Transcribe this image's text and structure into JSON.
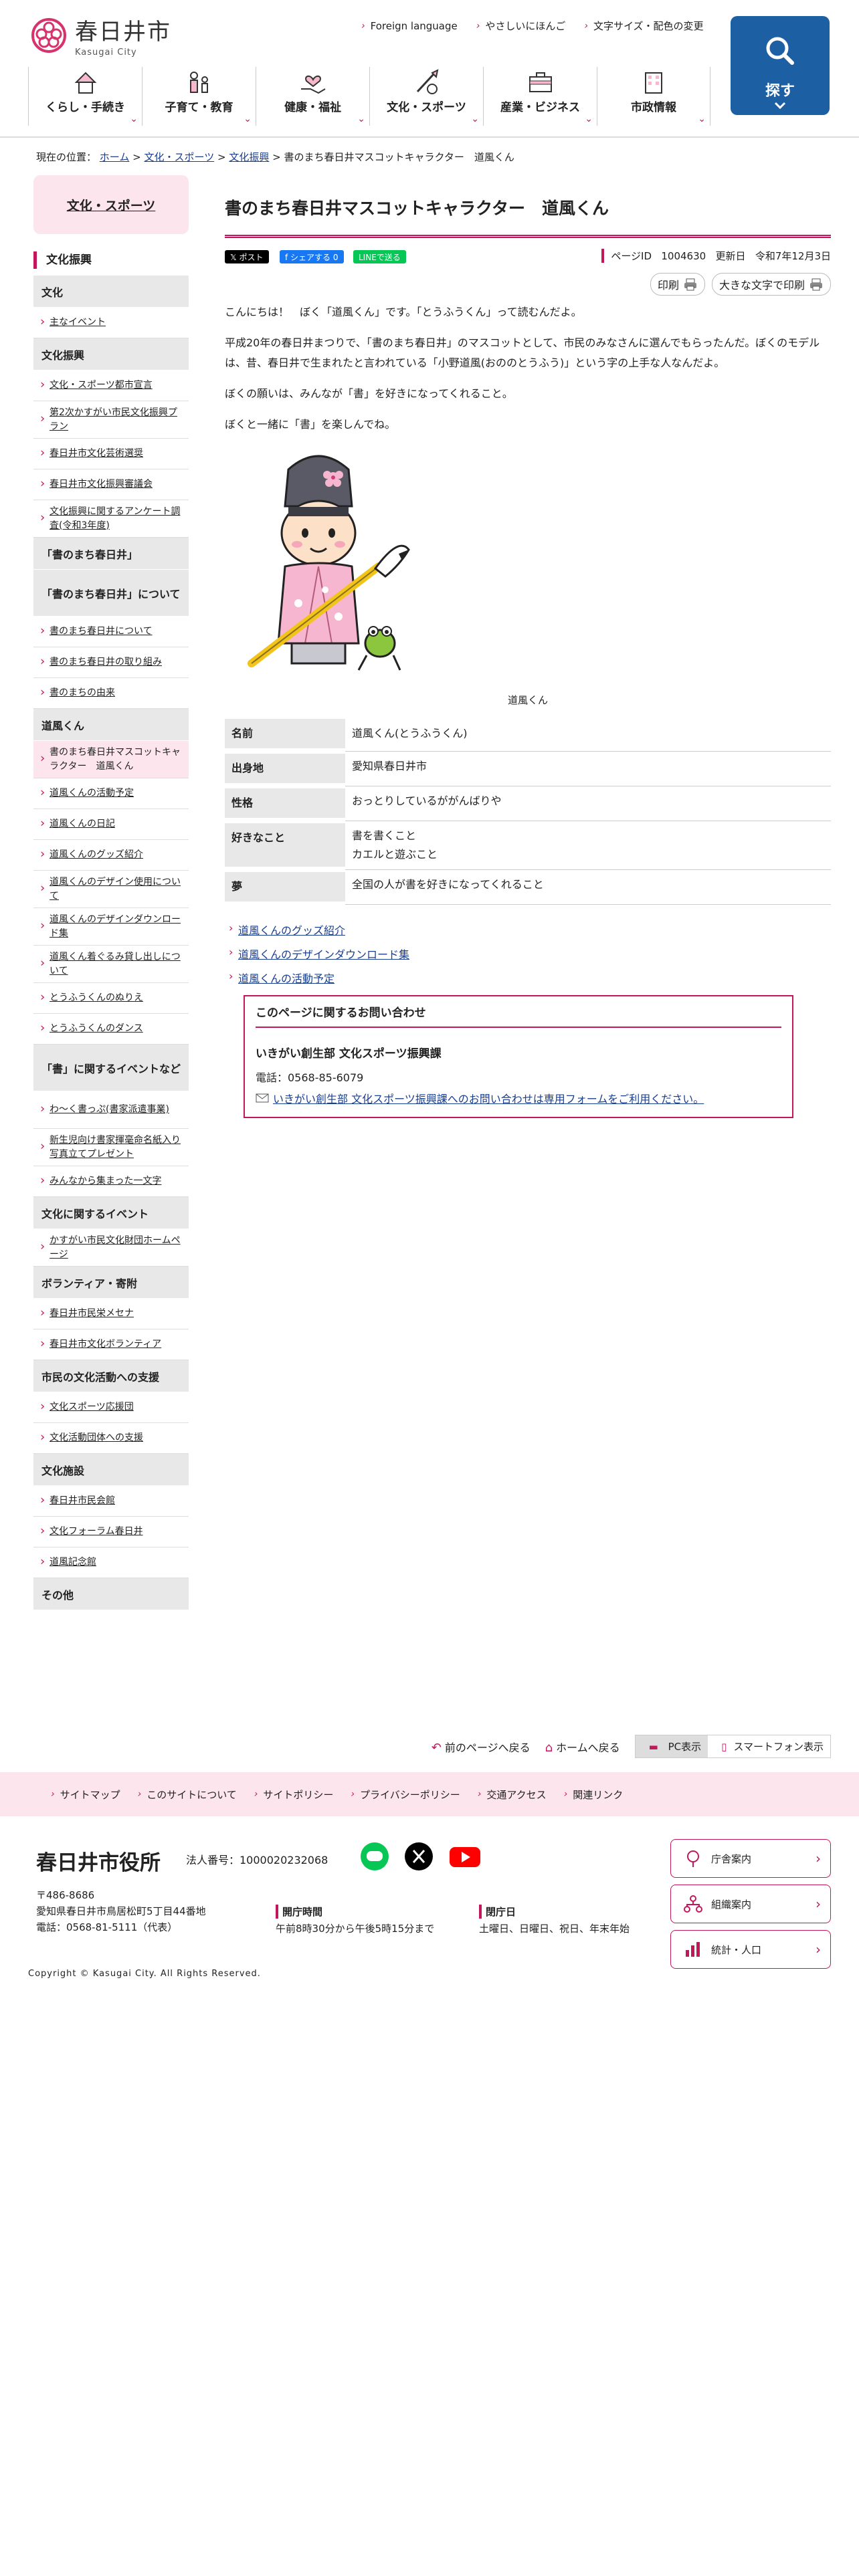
{
  "header": {
    "logo_ja": "春日井市",
    "logo_en": "Kasugai City",
    "utility": [
      "Foreign language",
      "やさしいにほんご",
      "文字サイズ・配色の変更"
    ],
    "search_label": "探す",
    "nav": [
      "くらし・手続き",
      "子育て・教育",
      "健康・福祉",
      "文化・スポーツ",
      "産業・ビジネス",
      "市政情報"
    ]
  },
  "breadcrumb": {
    "prefix": "現在の位置：",
    "home": "ホーム",
    "sep": ">",
    "c1": "文化・スポーツ",
    "c2": "文化振興",
    "current": "書のまち春日井マスコットキャラクター　道風くん"
  },
  "sidebar": {
    "title": "文化・スポーツ",
    "current_section": "文化振興",
    "items": [
      {
        "type": "cat",
        "label": "文化"
      },
      {
        "type": "link",
        "label": "主なイベント"
      },
      {
        "type": "cat",
        "label": "文化振興"
      },
      {
        "type": "link",
        "label": "文化・スポーツ都市宣言"
      },
      {
        "type": "link",
        "label": "第2次かすがい市民文化振興プラン"
      },
      {
        "type": "link",
        "label": "春日井市文化芸術選奨"
      },
      {
        "type": "link",
        "label": "春日井市文化振興審議会"
      },
      {
        "type": "link",
        "label": "文化振興に関するアンケート調査(令和3年度)"
      },
      {
        "type": "cat",
        "label": "「書のまち春日井」"
      },
      {
        "type": "cat",
        "label": "「書のまち春日井」について"
      },
      {
        "type": "link",
        "label": "書のまち春日井について"
      },
      {
        "type": "link",
        "label": "書のまち春日井の取り組み"
      },
      {
        "type": "link",
        "label": "書のまちの由来"
      },
      {
        "type": "cat",
        "label": "道風くん"
      },
      {
        "type": "link",
        "label": "書のまち春日井マスコットキャラクター　道風くん",
        "current": true
      },
      {
        "type": "link",
        "label": "道風くんの活動予定"
      },
      {
        "type": "link",
        "label": "道風くんの日記"
      },
      {
        "type": "link",
        "label": "道風くんのグッズ紹介"
      },
      {
        "type": "link",
        "label": "道風くんのデザイン使用について"
      },
      {
        "type": "link",
        "label": "道風くんのデザインダウンロード集"
      },
      {
        "type": "link",
        "label": "道風くん着ぐるみ貸し出しについて"
      },
      {
        "type": "link",
        "label": "とうふうくんのぬりえ"
      },
      {
        "type": "link",
        "label": "とうふうくんのダンス"
      },
      {
        "type": "cat",
        "label": "「書」に関するイベントなど"
      },
      {
        "type": "link",
        "label": "わ〜く書っぷ(書家派遣事業)"
      },
      {
        "type": "link",
        "label": "新生児向け書家揮毫命名紙入り写真立てプレゼント"
      },
      {
        "type": "link",
        "label": "みんなから集まった一文字"
      },
      {
        "type": "cat",
        "label": "文化に関するイベント"
      },
      {
        "type": "link",
        "label": "かすがい市民文化財団ホームページ"
      },
      {
        "type": "cat",
        "label": "ボランティア・寄附"
      },
      {
        "type": "link",
        "label": "春日井市民栄メセナ"
      },
      {
        "type": "link",
        "label": "春日井市文化ボランティア"
      },
      {
        "type": "cat",
        "label": "市民の文化活動への支援"
      },
      {
        "type": "link",
        "label": "文化スポーツ応援団"
      },
      {
        "type": "link",
        "label": "文化活動団体への支援"
      },
      {
        "type": "cat",
        "label": "文化施設"
      },
      {
        "type": "link",
        "label": "春日井市民会館"
      },
      {
        "type": "link",
        "label": "文化フォーラム春日井"
      },
      {
        "type": "link",
        "label": "道風記念館"
      },
      {
        "type": "cat",
        "label": "その他"
      }
    ]
  },
  "main": {
    "title": "書のまち春日井マスコットキャラクター　道風くん",
    "share": {
      "x": "ポスト",
      "fb": "シェアする 0",
      "line": "LINEで送る"
    },
    "page_id_label": "ページID",
    "page_id": "1004630",
    "updated_label": "更新日",
    "updated": "令和7年12月3日",
    "print": "印刷",
    "print_large": "大きな文字で印刷",
    "paragraphs": [
      "こんにちは！　ぼく「道風くん」です。「とうふうくん」って読むんだよ。",
      "平成20年の春日井まつりで、「書のまち春日井」のマスコットとして、市民のみなさんに選んでもらったんだ。ぼくのモデルは、昔、春日井で生まれたと言われている「小野道風(おののとうふう)」という字の上手な人なんだよ。",
      "ぼくの願いは、みんなが「書」を好きになってくれること。",
      "ぼくと一緒に「書」を楽しんでね。"
    ],
    "image_caption": "道風くん",
    "profile": [
      {
        "k": "名前",
        "v": "道風くん(とうふうくん)"
      },
      {
        "k": "出身地",
        "v": "愛知県春日井市"
      },
      {
        "k": "性格",
        "v": "おっとりしているががんばりや"
      },
      {
        "k": "好きなこと",
        "v": "書を書くこと",
        "v2": "カエルと遊ぶこと"
      },
      {
        "k": "夢",
        "v": "全国の人が書を好きになってくれること"
      }
    ],
    "related": [
      "道風くんのグッズ紹介",
      "道風くんのデザインダウンロード集",
      "道風くんの活動予定"
    ],
    "contact": {
      "heading": "このページに関するお問い合わせ",
      "dept": "いきがい創生部 文化スポーツ振興課",
      "tel": "電話：0568-85-6079",
      "form": "いきがい創生部 文化スポーツ振興課へのお問い合わせは専用フォームをご利用ください。"
    }
  },
  "footer": {
    "back": "前のページへ戻る",
    "home": "ホームへ戻る",
    "pc": "PC表示",
    "sp": "スマートフォン表示",
    "nav": [
      "サイトマップ",
      "このサイトについて",
      "サイトポリシー",
      "プライバシーポリシー",
      "交通アクセス",
      "関連リンク"
    ],
    "org": "春日井市役所",
    "corp": "法人番号：1000020232068",
    "postal": "〒486-8686",
    "address": "愛知県春日井市鳥居松町5丁目44番地",
    "phone": "電話：0568-81-5111（代表）",
    "hours_title": "開庁時間",
    "hours": "午前8時30分から午後5時15分まで",
    "closed_title": "閉庁日",
    "closed": "土曜日、日曜日、祝日、年末年始",
    "side": [
      "庁舎案内",
      "組織案内",
      "統計・人口"
    ],
    "copyright": "Copyright © Kasugai City. All Rights Reserved."
  }
}
